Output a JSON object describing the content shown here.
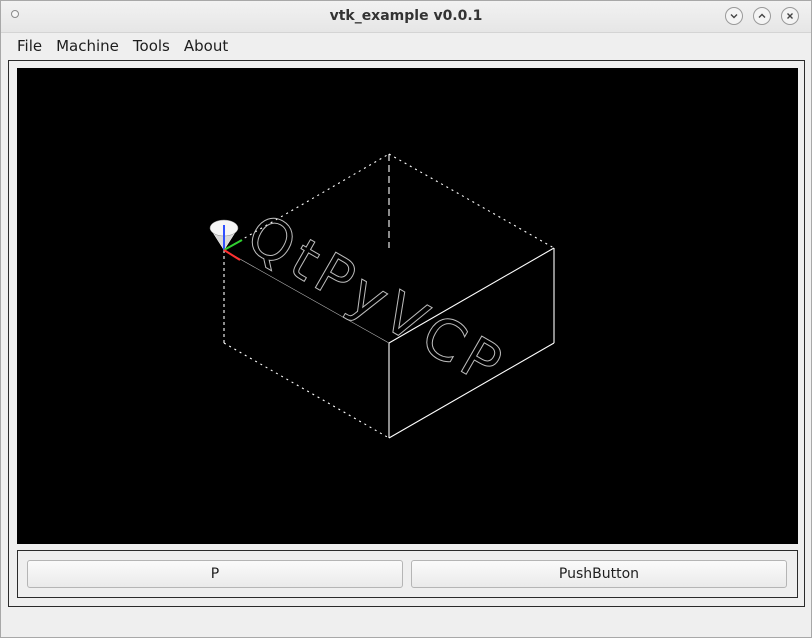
{
  "window": {
    "title": "vtk_example v0.0.1"
  },
  "menubar": {
    "items": [
      "File",
      "Machine",
      "Tools",
      "About"
    ]
  },
  "viewport": {
    "background": "#000000",
    "overlay_text": "QtPyVCP",
    "line_color": "#ffffff",
    "axis_colors": {
      "x": "#ff3030",
      "y": "#30d030",
      "z": "#3050ff"
    }
  },
  "buttons": {
    "left_label": "P",
    "right_label": "PushButton"
  }
}
